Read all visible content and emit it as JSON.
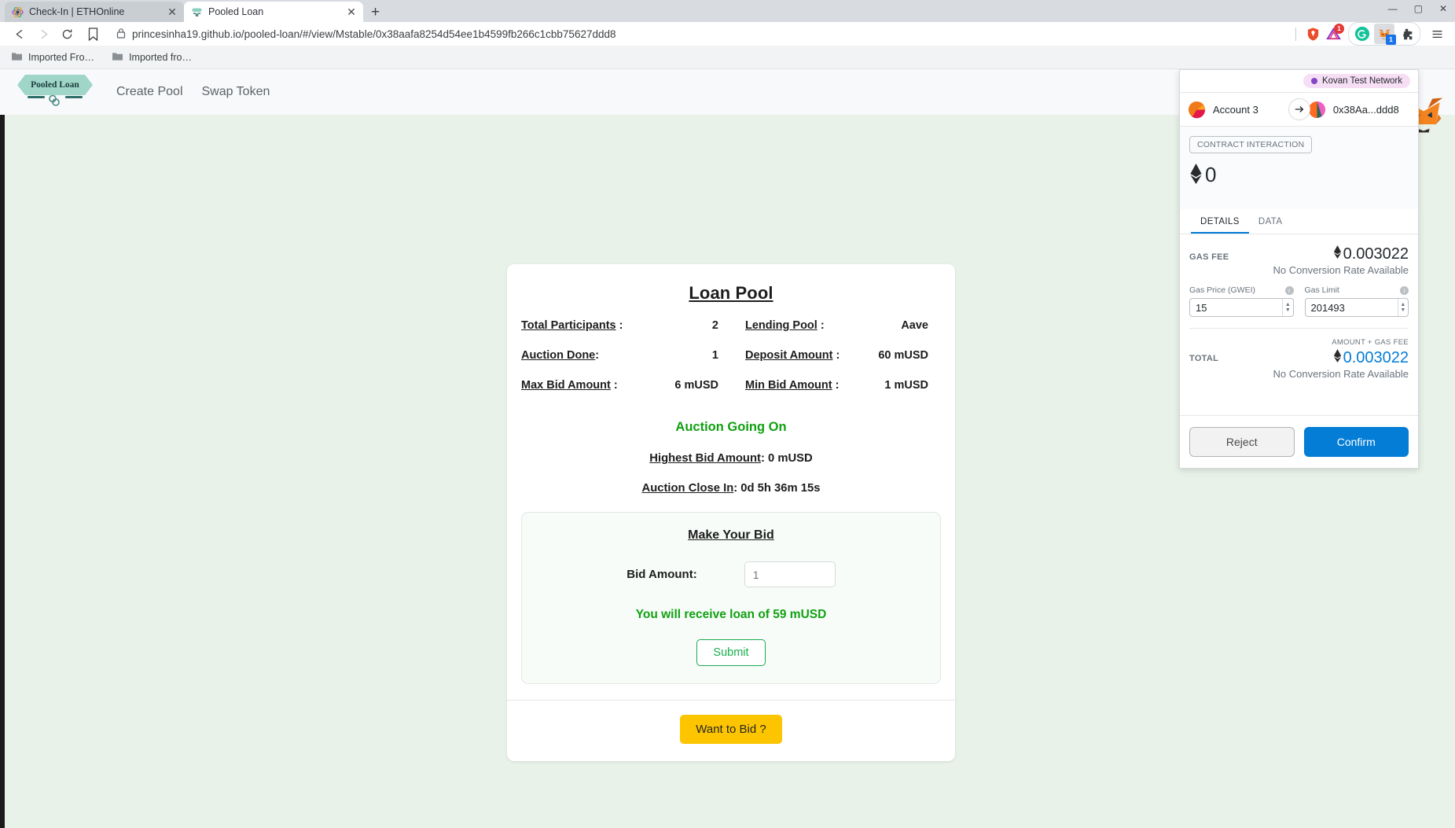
{
  "browser": {
    "tabs": [
      {
        "title": "Check-In | ETHOnline",
        "active": false,
        "favicon": "ethonline-icon"
      },
      {
        "title": "Pooled Loan",
        "active": true,
        "favicon": "pooled-loan-icon"
      }
    ],
    "new_tab_label": "+",
    "window_controls": {
      "minimize": "—",
      "maximize": "▢",
      "close": "✕"
    },
    "nav": {
      "back": "back-arrow-icon",
      "forward": "forward-arrow-icon",
      "reload": "reload-icon"
    },
    "omnibox": {
      "url": "princesinha19.github.io/pooled-loan/#/view/Mstable/0x38aafa8254d54ee1b4599fb266c1cbb75627ddd8",
      "lock": "lock-icon",
      "bookmark": "bookmark-icon"
    },
    "toolbar_icons": [
      {
        "name": "brave-shields-icon",
        "badge": ""
      },
      {
        "name": "extension-triangle-icon",
        "badge": "1"
      },
      {
        "name": "grammarly-icon",
        "badge": ""
      },
      {
        "name": "metamask-fox-icon",
        "badge": "1"
      },
      {
        "name": "extensions-puzzle-icon",
        "badge": ""
      },
      {
        "name": "browser-menu-icon",
        "badge": ""
      }
    ],
    "bookmarks": [
      {
        "label": "Imported Fro…",
        "icon": "folder-icon"
      },
      {
        "label": "Imported fro…",
        "icon": "folder-icon"
      }
    ]
  },
  "site": {
    "logo_text": "Pooled Loan",
    "nav_links": [
      "Create Pool",
      "Swap Token"
    ],
    "background_color": "#e8f2e8",
    "accent_green": "#12a012",
    "cta_color": "#fdc500"
  },
  "loan_pool": {
    "title": "Loan Pool",
    "stats": [
      {
        "label": "Total Participants",
        "sep": ":",
        "value": "2"
      },
      {
        "label": "Lending Pool",
        "sep": ":",
        "value": "Aave"
      },
      {
        "label": "Auction Done",
        "sep": ":",
        "value": "1"
      },
      {
        "label": "Deposit Amount",
        "sep": ":",
        "value": "60 mUSD"
      },
      {
        "label": "Max Bid Amount",
        "sep": ":",
        "value": "6 mUSD"
      },
      {
        "label": "Min Bid Amount",
        "sep": ":",
        "value": "1 mUSD"
      }
    ],
    "auction_status": "Auction Going On",
    "highest_bid_label": "Highest Bid Amount",
    "highest_bid_value": ": 0 mUSD",
    "auction_close_label": "Auction Close In",
    "auction_close_value": ": 0d 5h 36m 15s",
    "bid_panel": {
      "title": "Make Your Bid",
      "input_label": "Bid Amount:",
      "input_placeholder": "1",
      "input_value": "",
      "receive_message": "You will receive loan of 59 mUSD",
      "submit_label": "Submit"
    },
    "footer_cta": "Want to Bid ?"
  },
  "metamask": {
    "network": "Kovan Test Network",
    "network_dot_color": "#8247c5",
    "from_account": "Account 3",
    "to_account": "0x38Aa...ddd8",
    "transfer_arrow": "arrow-right-icon",
    "interaction_badge": "CONTRACT INTERACTION",
    "amount": "0",
    "tabs": [
      {
        "label": "DETAILS",
        "active": true
      },
      {
        "label": "DATA",
        "active": false
      }
    ],
    "gas_fee_label": "GAS FEE",
    "gas_fee_amount": "0.003022",
    "gas_fee_conversion": "No Conversion Rate Available",
    "gas_price_label": "Gas Price (GWEI)",
    "gas_price_value": "15",
    "gas_limit_label": "Gas Limit",
    "gas_limit_value": "201493",
    "amount_gas_fee_label": "AMOUNT + GAS FEE",
    "total_label": "TOTAL",
    "total_amount": "0.003022",
    "total_conversion": "No Conversion Rate Available",
    "total_color": "#037dd6",
    "reject_label": "Reject",
    "confirm_label": "Confirm"
  }
}
